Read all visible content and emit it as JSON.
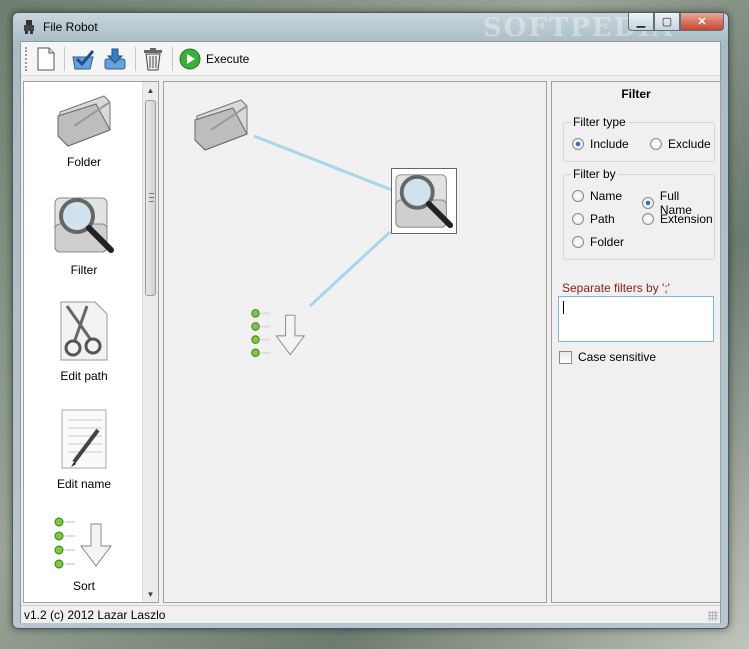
{
  "window": {
    "title": "File Robot",
    "controls": {
      "minimize": "▁",
      "maximize": "▢",
      "close": "✕"
    }
  },
  "toolbar": {
    "new_icon": "new-document-icon",
    "open_icon": "open-checkmark-icon",
    "save_icon": "save-download-icon",
    "delete_icon": "trash-icon",
    "execute_icon": "play-icon",
    "execute_label": "Execute"
  },
  "palette": {
    "items": [
      {
        "label": "Folder",
        "icon": "folder-icon"
      },
      {
        "label": "Filter",
        "icon": "magnifier-filter-icon"
      },
      {
        "label": "Edit path",
        "icon": "scissors-icon"
      },
      {
        "label": "Edit name",
        "icon": "notepad-pencil-icon"
      },
      {
        "label": "Sort",
        "icon": "sort-arrow-icon"
      }
    ]
  },
  "canvas": {
    "nodes": [
      {
        "type": "folder",
        "icon": "folder-icon"
      },
      {
        "type": "filter",
        "icon": "magnifier-filter-icon",
        "selected": true
      },
      {
        "type": "sort",
        "icon": "sort-arrow-icon"
      }
    ],
    "link_color": "#a9d6ea"
  },
  "properties": {
    "title": "Filter",
    "filter_type": {
      "label": "Filter type",
      "options": [
        {
          "label": "Include",
          "checked": true
        },
        {
          "label": "Exclude",
          "checked": false
        }
      ]
    },
    "filter_by": {
      "label": "Filter by",
      "options": [
        {
          "label": "Name",
          "checked": false
        },
        {
          "label": "Full Name",
          "checked": true
        },
        {
          "label": "Path",
          "checked": false
        },
        {
          "label": "Extension",
          "checked": false
        },
        {
          "label": "Folder",
          "checked": false
        }
      ]
    },
    "separator_hint": "Separate filters by ';'",
    "filter_value": "",
    "case_sensitive": {
      "label": "Case sensitive",
      "checked": false
    }
  },
  "status": {
    "text": "v1.2 (c) 2012 Lazar Laszlo"
  },
  "watermark": "SOFTPEDIA"
}
